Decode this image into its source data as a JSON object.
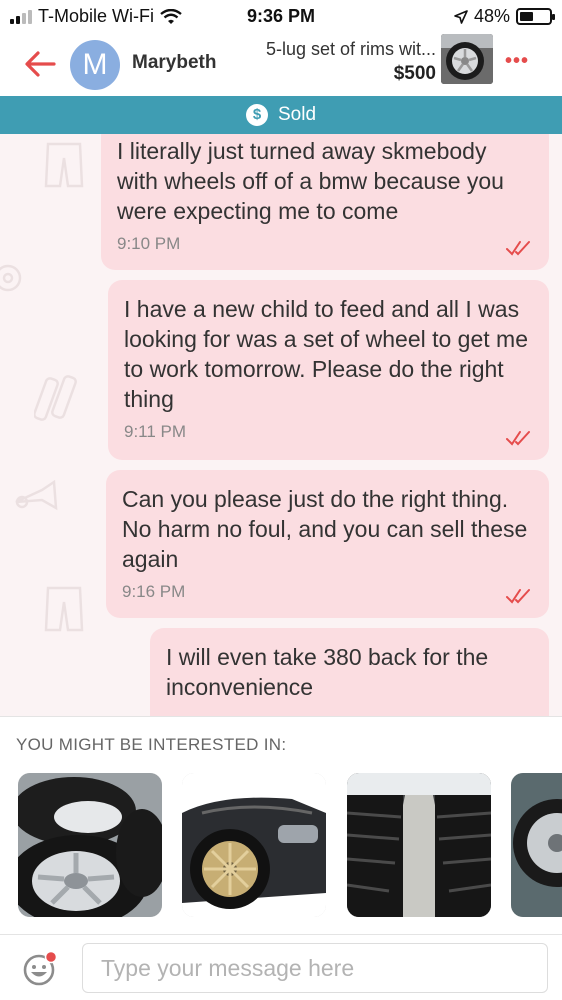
{
  "status_bar": {
    "carrier": "T-Mobile Wi-Fi",
    "time": "9:36 PM",
    "battery": "48%",
    "battery_level": 0.48
  },
  "header": {
    "avatar_letter": "M",
    "username": "Marybeth",
    "item_title": "5-lug set of rims wit...",
    "item_price": "$500"
  },
  "banner": {
    "label": "Sold"
  },
  "messages": [
    {
      "text": "I literally just turned away skmebody with wheels off of a bmw because you were expecting me to come",
      "time": "9:10 PM"
    },
    {
      "text": "I have a new child to feed and all I was looking for was a set of wheel to get me to work tomorrow. Please do the right thing",
      "time": "9:11 PM"
    },
    {
      "text": "Can you please just do the right thing. No harm no foul, and you can sell these again",
      "time": "9:16 PM"
    },
    {
      "text": "I will even take 380 back for the inconvenience",
      "time": ""
    }
  ],
  "suggestions": {
    "label": "YOU MIGHT BE INTERESTED IN:"
  },
  "composer": {
    "placeholder": "Type your message here"
  },
  "colors": {
    "accent_red": "#e54c4c",
    "banner_teal": "#3f9db3",
    "bubble_pink": "#fbdde1",
    "avatar_blue": "#8aaee0"
  }
}
